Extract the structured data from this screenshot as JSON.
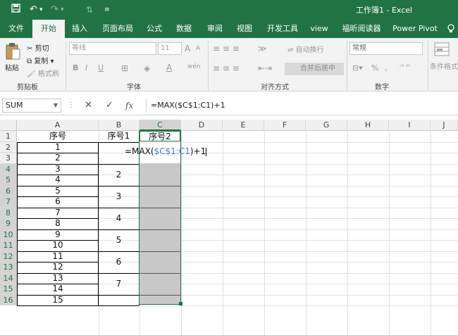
{
  "window": {
    "title": "工作簿1 - Excel",
    "quick_access": [
      "save-icon",
      "undo-icon",
      "redo-icon",
      "sort-icon",
      "customize-icon"
    ]
  },
  "tabs": [
    "文件",
    "开始",
    "插入",
    "页面布局",
    "公式",
    "数据",
    "审阅",
    "视图",
    "开发工具",
    "view",
    "福昕阅读器",
    "Power Pivot"
  ],
  "active_tab": "开始",
  "ribbon": {
    "clipboard": {
      "label": "剪贴板",
      "paste": "粘贴",
      "cut": "剪切",
      "copy": "复制",
      "format_painter": "格式刷"
    },
    "font": {
      "label": "字体",
      "font_name": "等线",
      "font_size": "11",
      "bold": "B",
      "italic": "I",
      "underline": "U",
      "grow": "A",
      "shrink": "A",
      "wen": "wén"
    },
    "alignment": {
      "label": "对齐方式",
      "wrap": "自动换行",
      "merge": "合并后居中"
    },
    "number": {
      "label": "数字",
      "format": "常规",
      "percent": "%",
      "comma": ","
    },
    "styles": {
      "conditional": "条件格式"
    }
  },
  "formula_bar": {
    "name_box": "SUM",
    "cancel": "✕",
    "enter": "✓",
    "fx": "fx",
    "content": "=MAX($C$1:C1)+1"
  },
  "columns": [
    "A",
    "B",
    "C",
    "D",
    "E",
    "F",
    "G",
    "H",
    "I",
    "J"
  ],
  "rows": [
    "1",
    "2",
    "3",
    "4",
    "5",
    "6",
    "7",
    "8",
    "9",
    "10",
    "11",
    "12",
    "13",
    "14",
    "15",
    "16"
  ],
  "headers": {
    "a": "序号",
    "b": "序号1",
    "c": "序号2"
  },
  "col_a": [
    "1",
    "2",
    "3",
    "4",
    "5",
    "6",
    "7",
    "8",
    "9",
    "10",
    "11",
    "12",
    "13",
    "14",
    "15"
  ],
  "col_b_merged": [
    "2",
    "3",
    "4",
    "5",
    "6",
    "7"
  ],
  "editing": {
    "prefix": "=MAX(",
    "ref": "$C$1:C1",
    "suffix": ")+1"
  },
  "colors": {
    "accent": "#217346",
    "selection_fill": "#c8c8c8",
    "ref_blue": "#4a7bd0"
  }
}
